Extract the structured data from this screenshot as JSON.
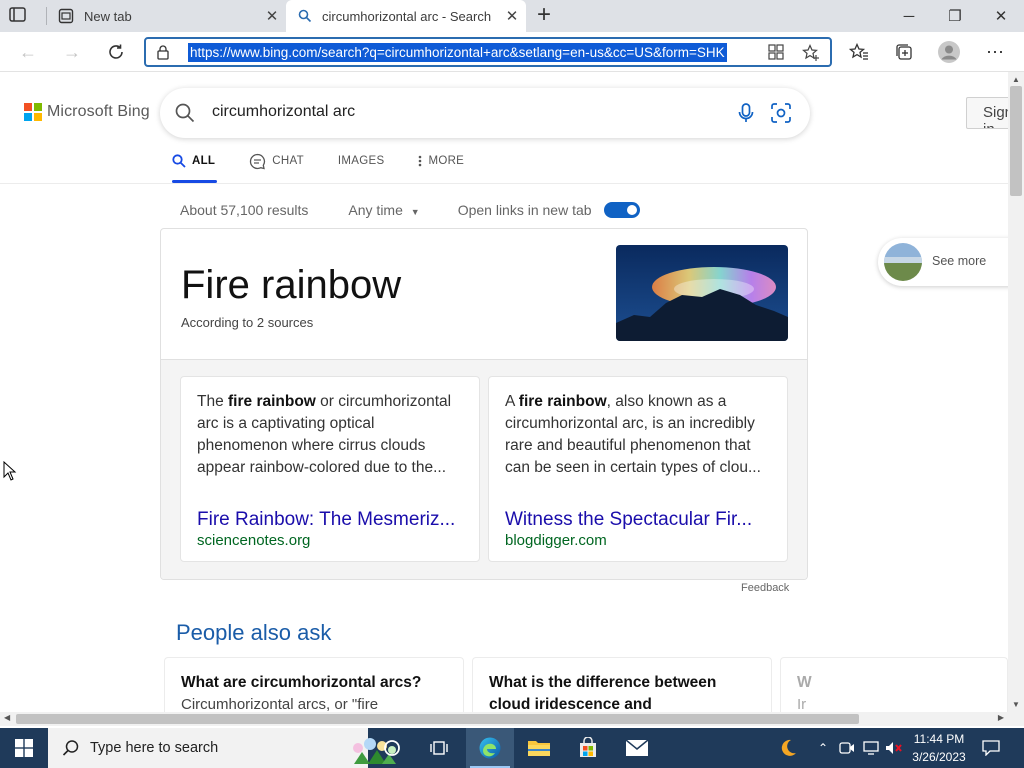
{
  "browser": {
    "tabs": [
      {
        "title": "New tab",
        "active": false
      },
      {
        "title": "circumhorizontal arc - Search",
        "active": true
      }
    ],
    "window_controls": {
      "minimize": "─",
      "maximize": "❐",
      "close": "✕"
    },
    "url": "https://www.bing.com/search?q=circumhorizontal+arc&setlang=en-us&cc=US&form=SHK"
  },
  "bing": {
    "logo_text": "Microsoft Bing",
    "query": "circumhorizontal arc",
    "sign_in_label": "Sign in",
    "scopes": [
      {
        "label": "ALL",
        "icon": "search-icon",
        "active": true
      },
      {
        "label": "CHAT",
        "icon": "chat-icon",
        "active": false
      },
      {
        "label": "IMAGES",
        "icon": "",
        "active": false
      },
      {
        "label": "MORE",
        "icon": "more-vertical-icon",
        "active": false
      }
    ],
    "results_count": "About 57,100 results",
    "time_filter": "Any time",
    "open_links_label": "Open links in new tab",
    "open_links_enabled": true
  },
  "answer": {
    "title": "Fire rainbow",
    "sources_note": "According to 2 sources",
    "cards": [
      {
        "snippet_pre": "The ",
        "snippet_bold": "fire rainbow",
        "snippet_post": " or circumhorizontal arc is a captivating optical phenomenon where cirrus clouds appear rainbow-colored due to the...",
        "link": "Fire Rainbow: The Mesmeriz...",
        "domain": "sciencenotes.org"
      },
      {
        "snippet_pre": "A ",
        "snippet_bold": "fire rainbow",
        "snippet_post": ", also known as a circumhorizontal arc, is an incredibly rare and beautiful phenomenon that can be seen in certain types of clou...",
        "link": "Witness the Spectacular Fir...",
        "domain": "blogdigger.com"
      }
    ],
    "feedback_label": "Feedback",
    "see_more_label": "See more"
  },
  "people_also_ask": {
    "title": "People also ask",
    "questions": [
      {
        "q": "What are circumhorizontal arcs?",
        "a": "Circumhorizontal arcs, or \"fire"
      },
      {
        "q": "What is the difference between cloud iridescence and circumhorizon arcs?",
        "a": ""
      },
      {
        "q": "W",
        "a": "Ir"
      }
    ]
  },
  "taskbar": {
    "search_placeholder": "Type here to search",
    "pinned": [
      "cortana-icon",
      "task-view-icon",
      "edge-icon",
      "file-explorer-icon",
      "store-icon",
      "mail-icon"
    ],
    "time": "11:44 PM",
    "date": "3/26/2023"
  },
  "colors": {
    "accent": "#174ae4",
    "link": "#1a0dab",
    "domain": "#006621",
    "paa_title": "#1a5ca8",
    "taskbar": "#1f3a5a"
  }
}
